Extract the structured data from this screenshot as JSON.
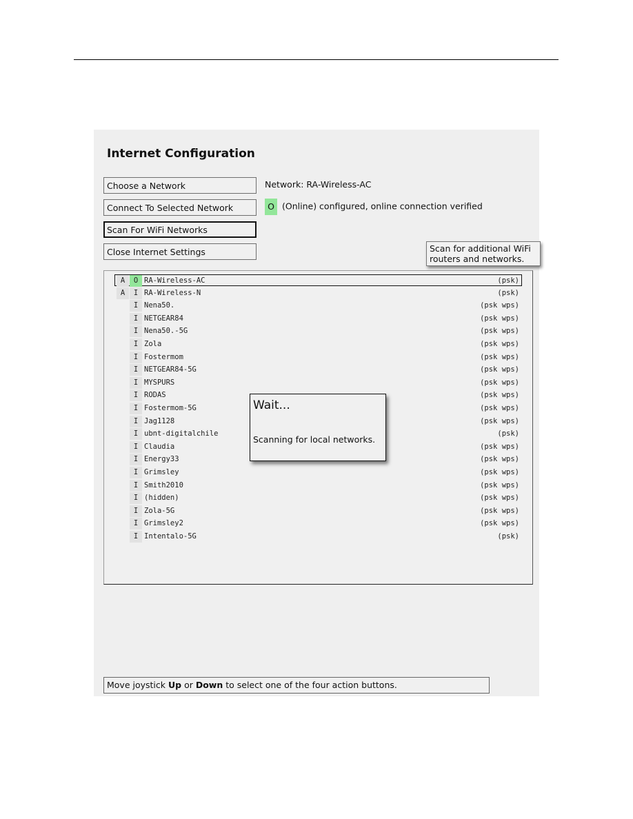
{
  "page": {
    "header_rule": true
  },
  "app": {
    "title": "Internet Configuration",
    "buttons": [
      {
        "id": "choose",
        "label": "Choose a Network",
        "focused": false
      },
      {
        "id": "connect",
        "label": "Connect To Selected Network",
        "focused": false
      },
      {
        "id": "scan",
        "label": "Scan For WiFi Networks",
        "focused": true
      },
      {
        "id": "close",
        "label": "Close Internet Settings",
        "focused": false
      }
    ],
    "network_label": "Network: RA-Wireless-AC",
    "status": {
      "badge": "O",
      "badge_color": "#93e69a",
      "text": "(Online) configured, online connection verified"
    },
    "tooltip": {
      "line1": "Scan for additional WiFi",
      "line2": "routers and networks."
    },
    "networks": [
      {
        "a": "A",
        "s": "O",
        "name": "RA-Wireless-AC",
        "sec": "(psk)",
        "selected": true,
        "online": true
      },
      {
        "a": "A",
        "s": "I",
        "name": "RA-Wireless-N",
        "sec": "(psk)"
      },
      {
        "a": "",
        "s": "I",
        "name": "Nena50.",
        "sec": "(psk wps)"
      },
      {
        "a": "",
        "s": "I",
        "name": "NETGEAR84",
        "sec": "(psk wps)"
      },
      {
        "a": "",
        "s": "I",
        "name": "Nena50.-5G",
        "sec": "(psk wps)"
      },
      {
        "a": "",
        "s": "I",
        "name": "Zola",
        "sec": "(psk wps)"
      },
      {
        "a": "",
        "s": "I",
        "name": "Fostermom",
        "sec": "(psk wps)"
      },
      {
        "a": "",
        "s": "I",
        "name": "NETGEAR84-5G",
        "sec": "(psk wps)"
      },
      {
        "a": "",
        "s": "I",
        "name": "MYSPURS",
        "sec": "(psk wps)"
      },
      {
        "a": "",
        "s": "I",
        "name": "RODAS",
        "sec": "(psk wps)"
      },
      {
        "a": "",
        "s": "I",
        "name": "Fostermom-5G",
        "sec": "(psk wps)"
      },
      {
        "a": "",
        "s": "I",
        "name": "Jag1128",
        "sec": "(psk wps)"
      },
      {
        "a": "",
        "s": "I",
        "name": "ubnt-digitalchile",
        "sec": "(psk)"
      },
      {
        "a": "",
        "s": "I",
        "name": "Claudia",
        "sec": "(psk wps)"
      },
      {
        "a": "",
        "s": "I",
        "name": "Energy33",
        "sec": "(psk wps)"
      },
      {
        "a": "",
        "s": "I",
        "name": "Grimsley",
        "sec": "(psk wps)"
      },
      {
        "a": "",
        "s": "I",
        "name": "Smith2010",
        "sec": "(psk wps)"
      },
      {
        "a": "",
        "s": "I",
        "name": "(hidden)",
        "sec": "(psk wps)"
      },
      {
        "a": "",
        "s": "I",
        "name": "Zola-5G",
        "sec": "(psk wps)"
      },
      {
        "a": "",
        "s": "I",
        "name": "Grimsley2",
        "sec": "(psk wps)"
      },
      {
        "a": "",
        "s": "I",
        "name": "Intentalo-5G",
        "sec": "(psk)"
      }
    ],
    "dialog": {
      "title": "Wait...",
      "message": "Scanning for local networks."
    },
    "help": {
      "part1": "Move joystick ",
      "bold1": "Up",
      "part2": " or ",
      "bold2": "Down",
      "part3": " to select one of the four action buttons."
    }
  }
}
